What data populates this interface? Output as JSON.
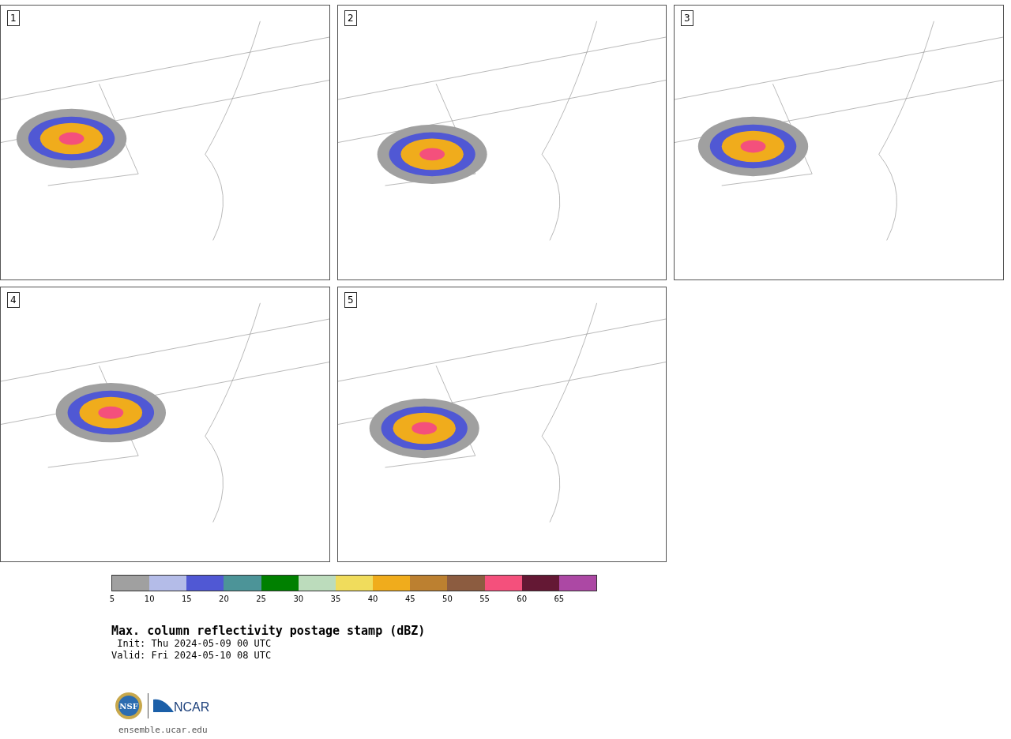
{
  "panels": [
    {
      "label": "1"
    },
    {
      "label": "2"
    },
    {
      "label": "3"
    },
    {
      "label": "4"
    },
    {
      "label": "5"
    }
  ],
  "legend": {
    "swatches": [
      {
        "color": "#a0a0a0",
        "tick": "5"
      },
      {
        "color": "#b4bce8",
        "tick": "10"
      },
      {
        "color": "#5058d4",
        "tick": "15"
      },
      {
        "color": "#4c9498",
        "tick": "20"
      },
      {
        "color": "#008000",
        "tick": "25"
      },
      {
        "color": "#bcdcbc",
        "tick": "30"
      },
      {
        "color": "#f0dc5c",
        "tick": "35"
      },
      {
        "color": "#f0ac1c",
        "tick": "40"
      },
      {
        "color": "#bc8030",
        "tick": "45"
      },
      {
        "color": "#8c5c40",
        "tick": "50"
      },
      {
        "color": "#f4507c",
        "tick": "55"
      },
      {
        "color": "#641834",
        "tick": "60"
      },
      {
        "color": "#ac48a4",
        "tick": "65"
      }
    ]
  },
  "title": "Max. column reflectivity postage stamp (dBZ)",
  "info_lines": [
    " Init: Thu 2024-05-09 00 UTC",
    "Valid: Fri 2024-05-10 08 UTC"
  ],
  "logos": {
    "seal": "NSF",
    "wordmark": "NCAR"
  },
  "footer": "ensemble.ucar.edu"
}
